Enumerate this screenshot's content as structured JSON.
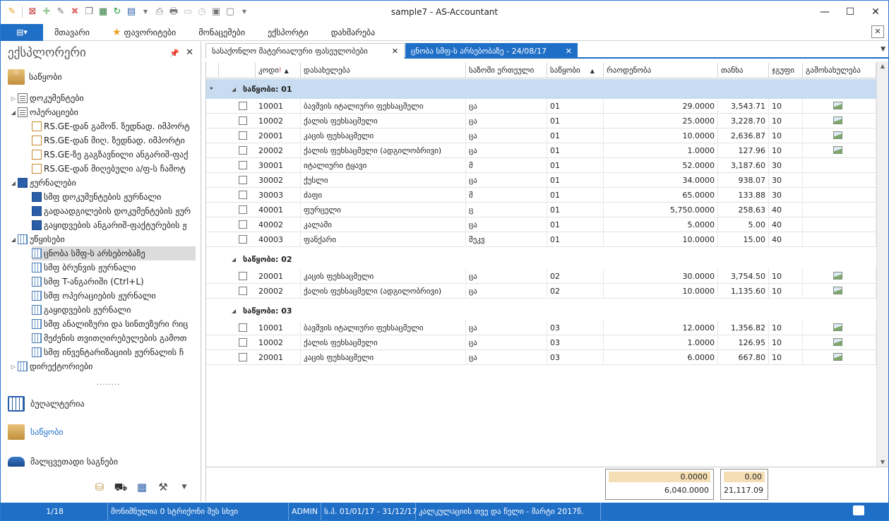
{
  "window": {
    "title": "sample7 - AS-Accountant"
  },
  "menu": {
    "items": [
      "მთავარი",
      "ფავორიტები",
      "მონაცემები",
      "ექსპორტი",
      "დახმარება"
    ]
  },
  "explorer": {
    "title": "ექსპლორერი",
    "group": "საწყობი",
    "tree": [
      {
        "label": "დოკუმენტები",
        "level": 0,
        "icon": "doc"
      },
      {
        "label": "ოპერაციები",
        "level": 0,
        "icon": "doc"
      },
      {
        "label": "RS.GE-დან გამოწ. ზედნად. იმპორტ",
        "level": 1,
        "icon": "rs"
      },
      {
        "label": "RS.GE-დან მიღ. ზედნად. იმპორტი",
        "level": 1,
        "icon": "rs"
      },
      {
        "label": "RS.GE-ზე გაგზავნილი ანგარიშ-ფაქ",
        "level": 1,
        "icon": "rs"
      },
      {
        "label": "RS.GE-დან მიღებული ა/ფ-ს ჩამოტ",
        "level": 1,
        "icon": "rs"
      },
      {
        "label": "ჟურნალები",
        "level": 0,
        "icon": "blue"
      },
      {
        "label": "სმფ დოკუმენტების ჟურნალი",
        "level": 1,
        "icon": "blue"
      },
      {
        "label": "გადაადგილების დოკუმენტების ჟურ",
        "level": 1,
        "icon": "blue"
      },
      {
        "label": "გაყიდვების ანგარიშ-ფაქტურების ჟ",
        "level": 1,
        "icon": "blue"
      },
      {
        "label": "უწყისები",
        "level": 0,
        "icon": "grid"
      },
      {
        "label": "ცნობა სმფ-ს არსებობაზე",
        "level": 1,
        "icon": "grid",
        "selected": true
      },
      {
        "label": "სმფ ბრუნვის ჟურნალი",
        "level": 1,
        "icon": "grid"
      },
      {
        "label": "სმფ T-ანგარიში (Ctrl+L)",
        "level": 1,
        "icon": "grid"
      },
      {
        "label": "სმფ ოპერაციების ჟურნალი",
        "level": 1,
        "icon": "grid"
      },
      {
        "label": "გაყიდვების ჟურნალი",
        "level": 1,
        "icon": "grid"
      },
      {
        "label": "სმფ ანალიზური და სინთეზური რიც",
        "level": 1,
        "icon": "grid"
      },
      {
        "label": "მეძენის თვითღირებულების გამოთ",
        "level": 1,
        "icon": "grid"
      },
      {
        "label": "სმფ ინვენტარიზაციის ჟურნალის ჩ",
        "level": 1,
        "icon": "grid"
      },
      {
        "label": "დირექტორიები",
        "level": 0,
        "icon": "grid"
      }
    ],
    "nav": {
      "books": "ბუღალტერია",
      "warehouse": "საწყობი",
      "lowcost": "მალცვეთადი საგნები"
    }
  },
  "tabs": [
    {
      "label": "სასაქონლო მატერიალური ფასეულობები"
    },
    {
      "label": "ცნობა სმფ-ს არსებობაზე - 24/08/17"
    }
  ],
  "grid": {
    "columns": [
      "კოდი",
      "დასახელება",
      "საზომი ერთეული",
      "საწყობი",
      "რაოდენობა",
      "თანხა",
      "ჯგუფი",
      "გამოსახულება"
    ],
    "groups": [
      {
        "title": "საწყობი: 01",
        "rows": [
          {
            "code": "10001",
            "name": "ბავშვის იტალიური ფეხსაცმელი",
            "unit": "ცა",
            "wh": "01",
            "qty": "29.0000",
            "amount": "3,543.71",
            "grp": "10",
            "img": true
          },
          {
            "code": "10002",
            "name": "ქალის ფეხსაცმელი",
            "unit": "ცა",
            "wh": "01",
            "qty": "25.0000",
            "amount": "3,228.70",
            "grp": "10",
            "img": true
          },
          {
            "code": "20001",
            "name": "კაცის ფეხსაცმელი",
            "unit": "ცა",
            "wh": "01",
            "qty": "10.0000",
            "amount": "2,636.87",
            "grp": "10",
            "img": true
          },
          {
            "code": "20002",
            "name": "ქალის ფეხსაცმელი (ადგილობრივი)",
            "unit": "ცა",
            "wh": "01",
            "qty": "1.0000",
            "amount": "127.96",
            "grp": "10",
            "img": true
          },
          {
            "code": "30001",
            "name": "იტალიური ტყავი",
            "unit": "მ",
            "wh": "01",
            "qty": "52.0000",
            "amount": "3,187.60",
            "grp": "30",
            "img": false
          },
          {
            "code": "30002",
            "name": "ქუსლი",
            "unit": "ცა",
            "wh": "01",
            "qty": "34.0000",
            "amount": "938.07",
            "grp": "30",
            "img": false
          },
          {
            "code": "30003",
            "name": "ძაფი",
            "unit": "მ",
            "wh": "01",
            "qty": "65.0000",
            "amount": "133.88",
            "grp": "30",
            "img": false
          },
          {
            "code": "40001",
            "name": "ფურცელი",
            "unit": "ც",
            "wh": "01",
            "qty": "5,750.0000",
            "amount": "258.63",
            "grp": "40",
            "img": false
          },
          {
            "code": "40002",
            "name": "კალამი",
            "unit": "ცა",
            "wh": "01",
            "qty": "5.0000",
            "amount": "5.00",
            "grp": "40",
            "img": false
          },
          {
            "code": "40003",
            "name": "ფანქარი",
            "unit": "შეკვ",
            "wh": "01",
            "qty": "10.0000",
            "amount": "15.00",
            "grp": "40",
            "img": false
          }
        ]
      },
      {
        "title": "საწყობი: 02",
        "rows": [
          {
            "code": "20001",
            "name": "კაცის ფეხსაცმელი",
            "unit": "ცა",
            "wh": "02",
            "qty": "30.0000",
            "amount": "3,754.50",
            "grp": "10",
            "img": true
          },
          {
            "code": "20002",
            "name": "ქალის ფეხსაცმელი (ადგილობრივი)",
            "unit": "ცა",
            "wh": "02",
            "qty": "10.0000",
            "amount": "1,135.60",
            "grp": "10",
            "img": true
          }
        ]
      },
      {
        "title": "საწყობი: 03",
        "rows": [
          {
            "code": "10001",
            "name": "ბავშვის იტალიური ფეხსაცმელი",
            "unit": "ცა",
            "wh": "03",
            "qty": "12.0000",
            "amount": "1,356.82",
            "grp": "10",
            "img": true
          },
          {
            "code": "10002",
            "name": "ქალის ფეხსაცმელი",
            "unit": "ცა",
            "wh": "03",
            "qty": "1.0000",
            "amount": "126.95",
            "grp": "10",
            "img": true
          },
          {
            "code": "20001",
            "name": "კაცის ფეხსაცმელი",
            "unit": "ცა",
            "wh": "03",
            "qty": "6.0000",
            "amount": "667.80",
            "grp": "10",
            "img": true
          }
        ]
      }
    ],
    "footer": {
      "qty_selected": "0.0000",
      "qty_total": "6,040.0000",
      "amount_selected": "0.00",
      "amount_total": "21,117.09"
    }
  },
  "status": {
    "record": "1/18",
    "selected": "მონიშნულია 0 სტრიქონი შეს სხვი",
    "user": "ADMIN",
    "period": "ს.პ. 01/01/17 - 31/12/17",
    "calc": "კალკულაციის თვე და წელი - მარტი 2017წ."
  }
}
